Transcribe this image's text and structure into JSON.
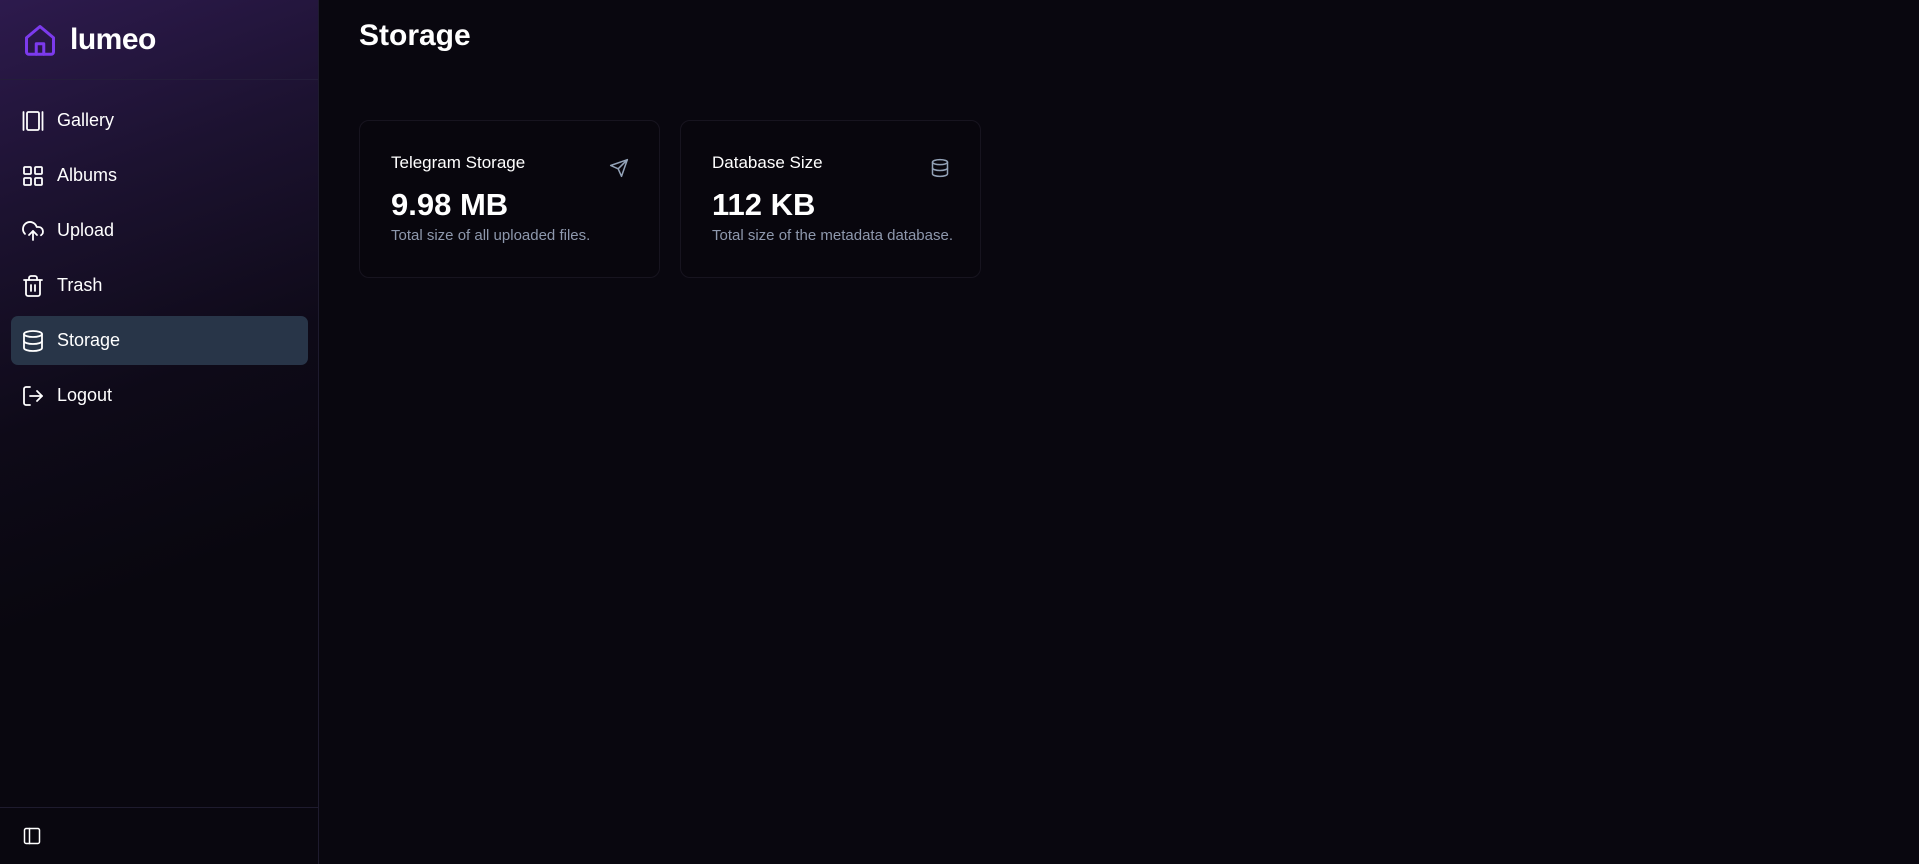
{
  "app": {
    "name": "lumeo",
    "logo_icon": "home-icon",
    "accent_color": "#7c3aed"
  },
  "sidebar": {
    "items": [
      {
        "label": "Gallery",
        "icon": "gallery-icon",
        "active": false
      },
      {
        "label": "Albums",
        "icon": "albums-grid-icon",
        "active": false
      },
      {
        "label": "Upload",
        "icon": "cloud-upload-icon",
        "active": false
      },
      {
        "label": "Trash",
        "icon": "trash-icon",
        "active": false
      },
      {
        "label": "Storage",
        "icon": "database-icon",
        "active": true
      },
      {
        "label": "Logout",
        "icon": "logout-icon",
        "active": false
      }
    ],
    "footer_icon": "sidebar-toggle-icon",
    "active_bg_color": "#283548"
  },
  "main": {
    "title": "Storage",
    "cards": [
      {
        "title": "Telegram Storage",
        "value": "9.98 MB",
        "description": "Total size of all uploaded files.",
        "icon": "send-icon"
      },
      {
        "title": "Database Size",
        "value": "112 KB",
        "description": "Total size of the metadata database.",
        "icon": "database-icon"
      }
    ]
  }
}
